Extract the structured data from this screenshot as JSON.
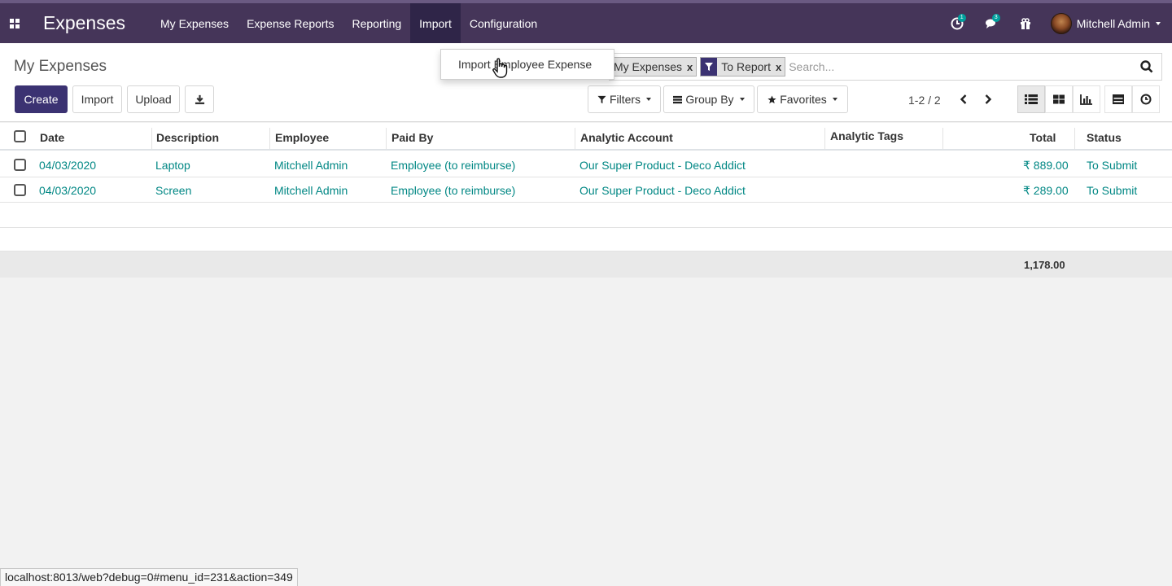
{
  "navbar": {
    "app_name": "Expenses",
    "menu": [
      "My Expenses",
      "Expense Reports",
      "Reporting",
      "Import",
      "Configuration"
    ],
    "active_menu": "Import",
    "activity_count": "1",
    "messages_count": "3",
    "user_name": "Mitchell Admin"
  },
  "control_panel": {
    "title": "My Expenses",
    "create_label": "Create",
    "import_label": "Import",
    "upload_label": "Upload",
    "search": {
      "facets": [
        "My Expenses",
        "To Report"
      ],
      "close_glyph": "x",
      "placeholder": "Search..."
    },
    "filters_label": "Filters",
    "group_by_label": "Group By",
    "favorites_label": "Favorites",
    "pager": "1-2 / 2"
  },
  "import_dropdown": {
    "items": [
      "Import Employee Expense"
    ]
  },
  "table": {
    "columns": [
      "Date",
      "Description",
      "Employee",
      "Paid By",
      "Analytic Account",
      "Analytic Tags",
      "Total",
      "Status"
    ],
    "rows": [
      {
        "date": "04/03/2020",
        "description": "Laptop",
        "employee": "Mitchell Admin",
        "paid_by": "Employee (to reimburse)",
        "analytic_account": "Our Super Product - Deco Addict",
        "analytic_tags": "",
        "total": "₹ 889.00",
        "status": "To Submit"
      },
      {
        "date": "04/03/2020",
        "description": "Screen",
        "employee": "Mitchell Admin",
        "paid_by": "Employee (to reimburse)",
        "analytic_account": "Our Super Product - Deco Addict",
        "analytic_tags": "",
        "total": "₹ 289.00",
        "status": "To Submit"
      }
    ],
    "grand_total": "1,178.00"
  },
  "status_bar": {
    "url": "localhost:8013/web?debug=0#menu_id=231&action=349"
  },
  "colors": {
    "navbar": "#453559",
    "primary": "#3b3272",
    "link": "#008784"
  }
}
